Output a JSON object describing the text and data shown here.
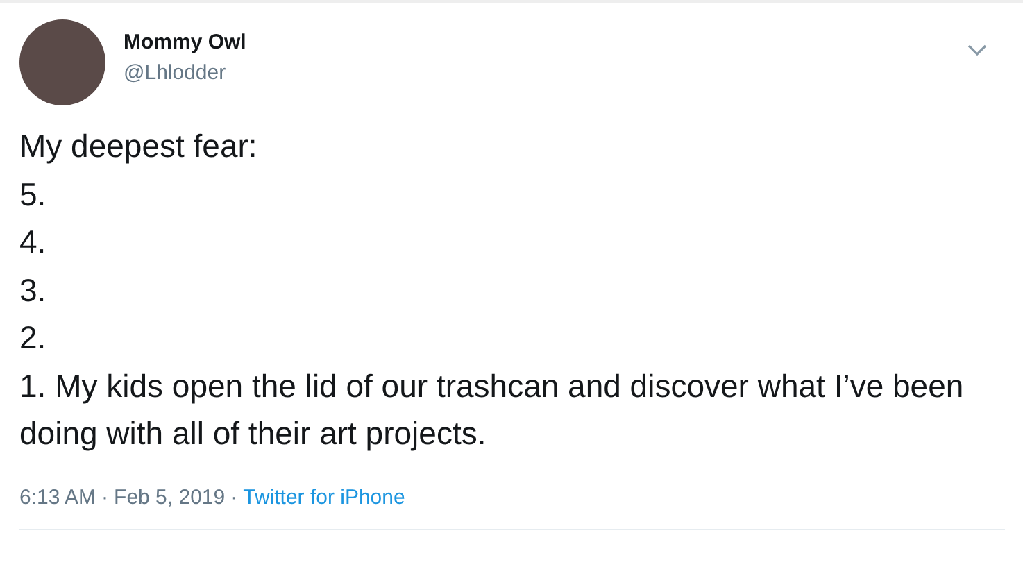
{
  "tweet": {
    "author": {
      "name": "Mommy Owl",
      "handle": "@Lhlodder"
    },
    "text": "My deepest fear:\n5.\n4.\n3.\n2.\n1. My kids open the lid of our trashcan and discover what I’ve been doing with all of their art projects.",
    "meta": {
      "time": "6:13 AM",
      "separator": "·",
      "date": "Feb 5, 2019",
      "source": "Twitter for iPhone"
    }
  }
}
